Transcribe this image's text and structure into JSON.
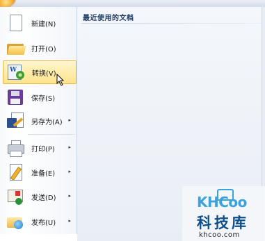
{
  "recent": {
    "title": "最近使用的文档"
  },
  "menu": {
    "items": [
      {
        "label": "新建(N)",
        "icon": "new-document-icon",
        "has_submenu": false,
        "highlighted": false
      },
      {
        "label": "打开(O)",
        "icon": "open-folder-icon",
        "has_submenu": false,
        "highlighted": false
      },
      {
        "label": "转换(V)",
        "icon": "convert-icon",
        "has_submenu": false,
        "highlighted": true
      },
      {
        "label": "保存(S)",
        "icon": "save-icon",
        "has_submenu": false,
        "highlighted": false
      },
      {
        "label": "另存为(A)",
        "icon": "save-as-icon",
        "has_submenu": true,
        "highlighted": false
      },
      {
        "label": "打印(P)",
        "icon": "printer-icon",
        "has_submenu": true,
        "highlighted": false
      },
      {
        "label": "准备(E)",
        "icon": "prepare-icon",
        "has_submenu": true,
        "highlighted": false
      },
      {
        "label": "发送(D)",
        "icon": "send-icon",
        "has_submenu": true,
        "highlighted": false
      },
      {
        "label": "发布(U)",
        "icon": "publish-icon",
        "has_submenu": true,
        "highlighted": false
      }
    ],
    "submenu_arrow": "▸"
  },
  "watermark": {
    "logo": "KHCoo",
    "name": "科技库",
    "url": "khcoo.com"
  },
  "colors": {
    "highlight": "#ffe48a",
    "highlight_border": "#e7b84a",
    "title_text": "#1f3b63"
  }
}
